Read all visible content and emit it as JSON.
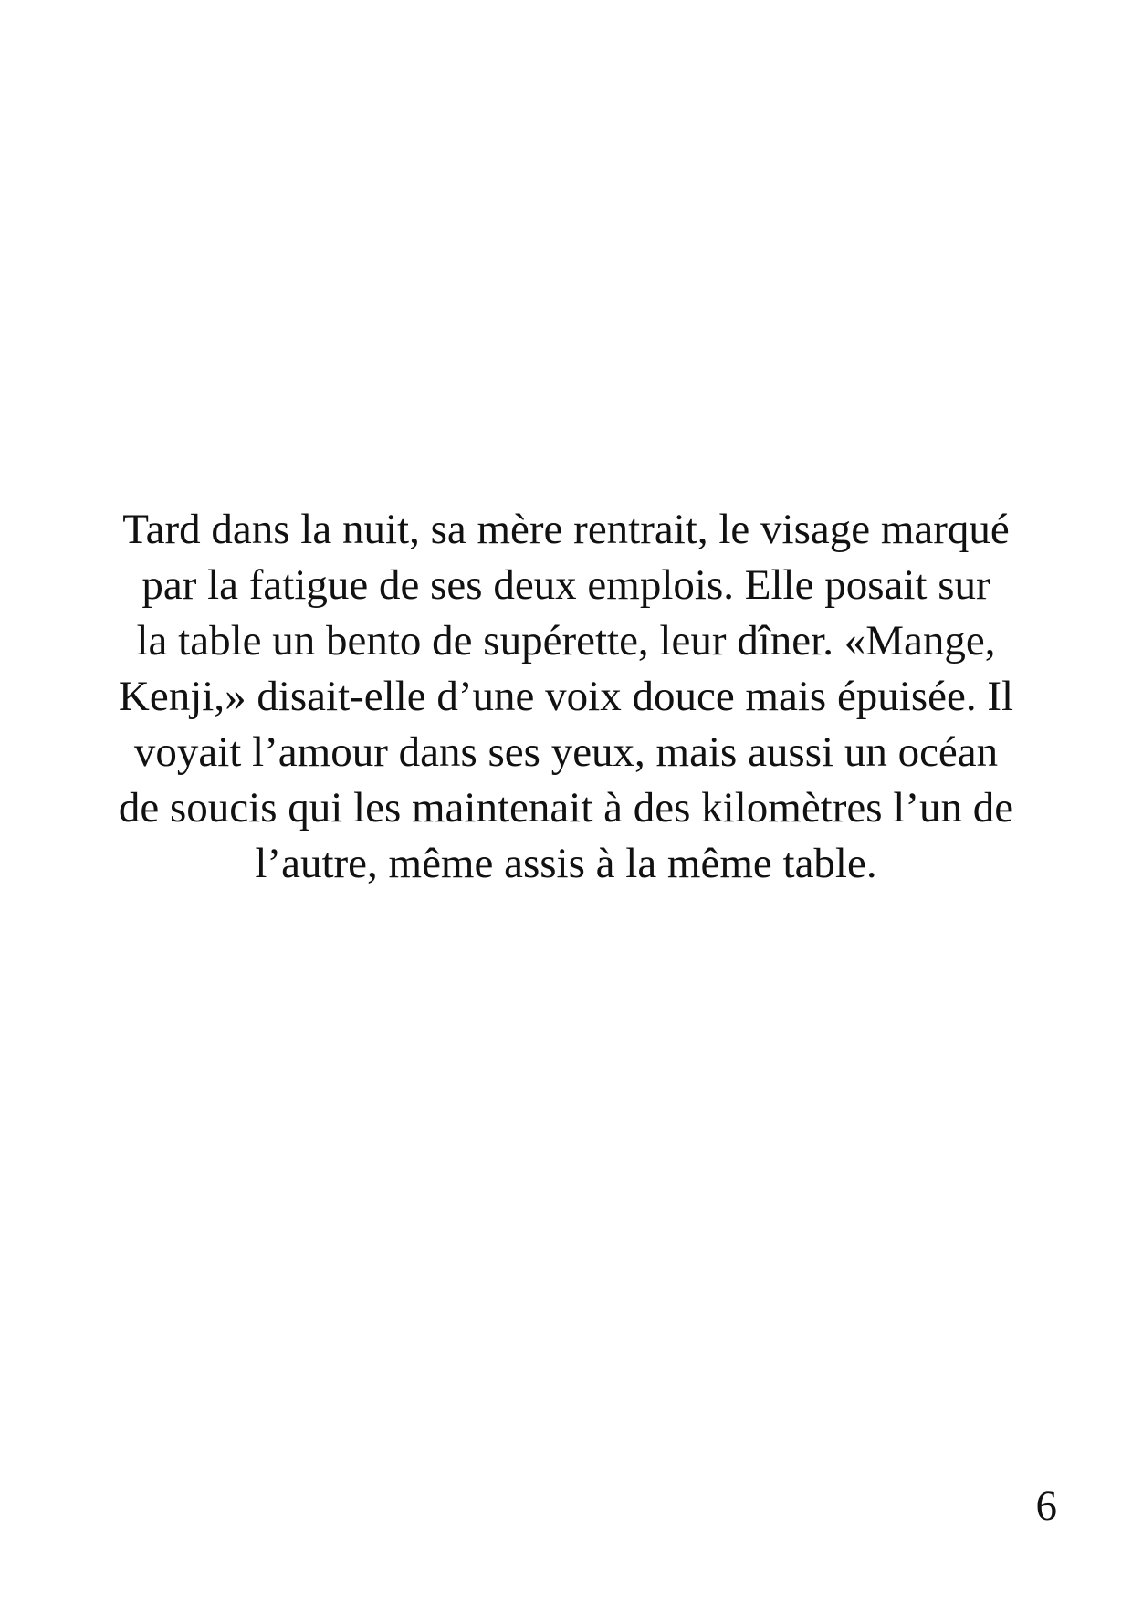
{
  "document": {
    "paragraph_lines": [
      "Tard dans la nuit, sa mère rentrait, le visage marqué",
      "par la fatigue de ses deux emplois. Elle posait sur",
      "la table un bento de supérette, leur dîner. «Mange,",
      "Kenji,» disait-elle d’une voix douce mais épuisée. Il",
      "voyait l’amour dans ses yeux, mais aussi un océan",
      "de soucis qui les maintenait à des kilomètres l’un de",
      "l’autre, même assis à la même table."
    ],
    "page_number": "6"
  },
  "colors": {
    "background": "#ffffff",
    "text": "#111111"
  }
}
